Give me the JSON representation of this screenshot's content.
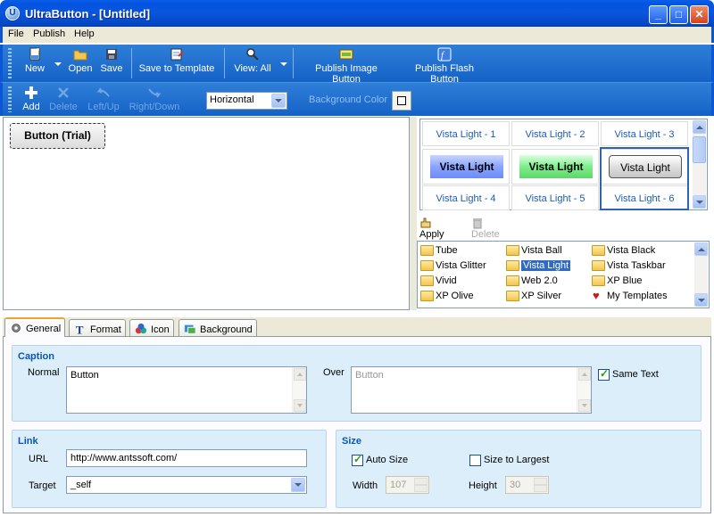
{
  "window": {
    "app_icon": "U",
    "title": "UltraButton - [Untitled]",
    "minimize": "_",
    "maximize": "□",
    "close": "✕"
  },
  "menu": [
    "File",
    "Publish",
    "Help"
  ],
  "toolbar1": {
    "new": "New",
    "open": "Open",
    "save": "Save",
    "save_template": "Save to Template",
    "view_all": "View: All",
    "publish_image": "Publish Image Button",
    "publish_flash": "Publish Flash Button"
  },
  "toolbar2": {
    "add": "Add",
    "delete": "Delete",
    "left_up": "Left/Up",
    "right_down": "Right/Down",
    "orientation": "Horizontal",
    "bg_color_label": "Background Color"
  },
  "canvas": {
    "button_caption": "Button (Trial)"
  },
  "gallery": {
    "labels_top": [
      "Vista Light - 1",
      "Vista Light - 2",
      "Vista Light - 3"
    ],
    "previews": [
      "Vista Light",
      "Vista Light",
      "Vista Light"
    ],
    "labels_bottom": [
      "Vista Light - 4",
      "Vista Light - 5",
      "Vista Light - 6"
    ],
    "apply": "Apply",
    "delete": "Delete"
  },
  "categories": [
    "Tube",
    "Vista Ball",
    "Vista Black",
    "Vista Glitter",
    "Vista Light",
    "Vista Taskbar",
    "Vivid",
    "Web 2.0",
    "XP Blue",
    "XP Olive",
    "XP Silver",
    "My Templates"
  ],
  "tabs": [
    "General",
    "Format",
    "Icon",
    "Background"
  ],
  "caption_group": {
    "title": "Caption",
    "normal_label": "Normal",
    "normal_value": "Button",
    "over_label": "Over",
    "over_value": "Button",
    "same_text": "Same Text"
  },
  "link_group": {
    "title": "Link",
    "url_label": "URL",
    "url_value": "http://www.antssoft.com/",
    "target_label": "Target",
    "target_value": "_self"
  },
  "size_group": {
    "title": "Size",
    "auto_size": "Auto Size",
    "size_to_largest": "Size to Largest",
    "width_label": "Width",
    "width_value": "107",
    "height_label": "Height",
    "height_value": "30"
  },
  "colors": {
    "titlebar": "#0454e0",
    "toolbar": "#1f6fd0",
    "group_bg": "#ddeefb",
    "selection": "#316ac5"
  }
}
